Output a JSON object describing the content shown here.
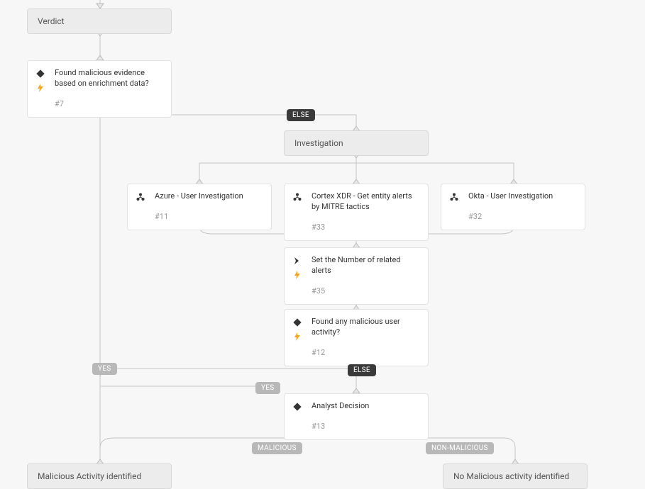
{
  "sections": {
    "verdict": "Verdict",
    "investigation": "Investigation",
    "malicious": "Malicious Activity identified",
    "nonmalicious": "No Malicious activity identified"
  },
  "tasks": {
    "t7": {
      "title": "Found malicious evidence based on enrichment data?",
      "id": "#7"
    },
    "t11": {
      "title": "Azure - User Investigation",
      "id": "#11"
    },
    "t33": {
      "title": "Cortex XDR - Get entity alerts by MITRE tactics",
      "id": "#33"
    },
    "t32": {
      "title": "Okta - User Investigation",
      "id": "#32"
    },
    "t35": {
      "title": "Set the Number of related alerts",
      "id": "#35"
    },
    "t12": {
      "title": "Found any malicious user activity?",
      "id": "#12"
    },
    "t13": {
      "title": "Analyst Decision",
      "id": "#13"
    }
  },
  "labels": {
    "else": "ELSE",
    "yes": "YES",
    "malicious": "MALICIOUS",
    "nonmalicious": "NON-MALICIOUS"
  }
}
